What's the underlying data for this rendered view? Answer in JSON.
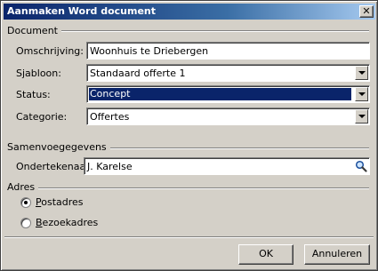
{
  "window": {
    "title": "Aanmaken Word document",
    "close_glyph": "✕"
  },
  "document_group": {
    "label": "Document",
    "omschrijving_label": "Omschrijving:",
    "omschrijving_value": "Woonhuis te Driebergen",
    "sjabloon_label": "Sjabloon:",
    "sjabloon_value": "Standaard offerte 1",
    "status_label": "Status:",
    "status_value": "Concept",
    "categorie_label": "Categorie:",
    "categorie_value": "Offertes"
  },
  "samenvoeg_group": {
    "label": "Samenvoegegevens",
    "ondertekenaar_label": "Ondertekenaar:",
    "ondertekenaar_value": "J. Karelse"
  },
  "adres_group": {
    "label": "Adres",
    "options": [
      {
        "label_rest": "ostadres",
        "accesskey": "P",
        "checked": true
      },
      {
        "label_rest": "ezoekadres",
        "accesskey": "B",
        "checked": false
      }
    ]
  },
  "buttons": {
    "ok": "OK",
    "cancel": "Annuleren"
  },
  "colors": {
    "titlebar_start": "#0a246a",
    "titlebar_end": "#a6caf0",
    "face": "#d4d0c8",
    "selection": "#0a246a"
  },
  "icons": {
    "lookup": "magnifier-icon",
    "dropdown": "chevron-down-icon",
    "close": "close-icon"
  }
}
